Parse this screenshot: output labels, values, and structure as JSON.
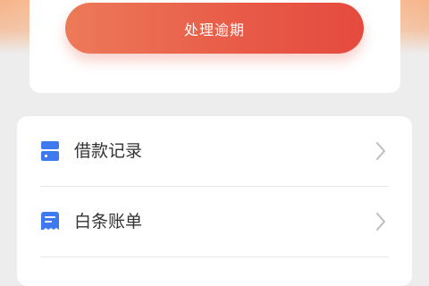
{
  "overdue_card": {
    "button_label": "处理逾期"
  },
  "menu": {
    "items": [
      {
        "label": "借款记录",
        "icon": "loan-record-icon"
      },
      {
        "label": "白条账单",
        "icon": "bill-icon"
      }
    ]
  },
  "colors": {
    "accent_gradient_start": "#ec7a59",
    "accent_gradient_end": "#e54a3e",
    "icon_blue": "#3f79f0",
    "background": "#ededed",
    "text": "#333333"
  }
}
